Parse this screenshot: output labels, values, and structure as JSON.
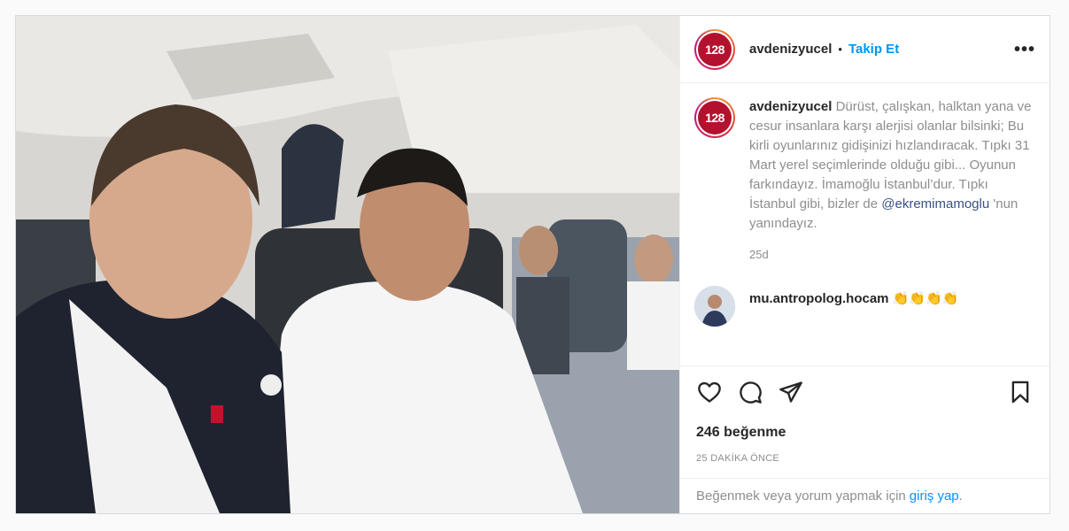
{
  "post": {
    "username": "avdenizyucel",
    "avatar_text": "128",
    "follow_label": "Takip Et",
    "dot": "•",
    "more_label": "•••",
    "caption": "Dürüst, çalışkan, halktan yana ve cesur insanlara karşı alerjisi olanlar bilsinki; Bu kirli oyunlarınız gidişinizi hızlandıracak. Tıpkı 31 Mart yerel seçimlerinde olduğu gibi... Oyunun farkındayız. İmamoğlu İstanbul’dur. Tıpkı İstanbul gibi, bizler de",
    "caption_mention": "@ekremimamoglu",
    "caption_tail": "'nun yanındayız.",
    "age": "25d",
    "comments": [
      {
        "username": "mu.antropolog.hocam",
        "text": "👏👏👏👏"
      }
    ],
    "likes": "246 beğenme",
    "timestamp": "25 DAKİKA ÖNCE",
    "login_prompt": "Beğenmek veya yorum yapmak için",
    "login_link": "giriş yap",
    "login_end": "."
  },
  "icons": [
    "heart-icon",
    "comment-icon",
    "share-icon",
    "bookmark-icon"
  ],
  "colors": {
    "link": "#0095f6",
    "mention": "#385185",
    "avatar_bg": "#b3122e"
  }
}
